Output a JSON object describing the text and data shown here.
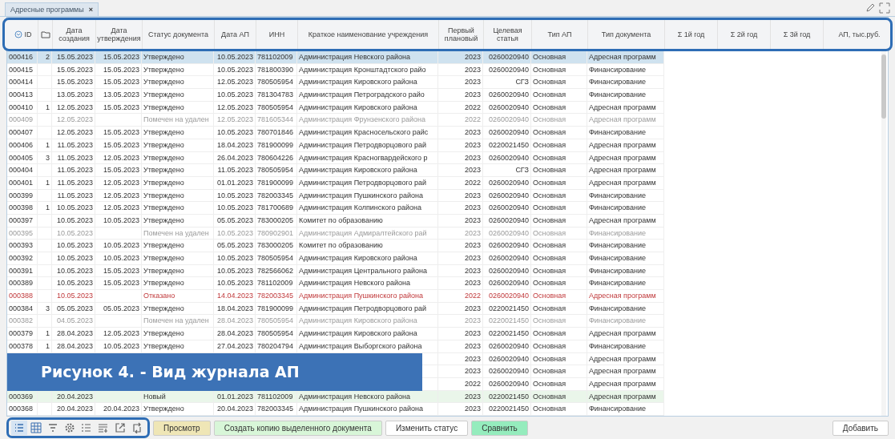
{
  "tab": {
    "label": "Адресные программы",
    "close": "×"
  },
  "columns": [
    "ID",
    "",
    "Дата создания",
    "Дата утверждения",
    "Статус документа",
    "Дата АП",
    "ИНН",
    "Краткое наименование учреждения",
    "Первый плановый",
    "Целевая статья",
    "Тип АП",
    "Тип документа",
    "Σ 1й год",
    "Σ 2й год",
    "Σ 3й год",
    "АП, тыс.руб."
  ],
  "rows": [
    {
      "covered": false,
      "kind": "approved",
      "selected": true,
      "cells": [
        "000416",
        "2",
        "15.05.2023",
        "15.05.2023",
        "Утверждено",
        "10.05.2023",
        "781102009",
        "Администрация Невского района",
        "2023",
        "0260020940",
        "Основная",
        "Адресная программ"
      ]
    },
    {
      "covered": false,
      "kind": "approved",
      "selected": false,
      "cells": [
        "000415",
        "",
        "15.05.2023",
        "15.05.2023",
        "Утверждено",
        "10.05.2023",
        "781800390",
        "Администрация Кронштадтского райо",
        "2023",
        "0260020940",
        "Основная",
        "Финансирование"
      ]
    },
    {
      "covered": false,
      "kind": "approved",
      "selected": false,
      "cells": [
        "000414",
        "",
        "15.05.2023",
        "15.05.2023",
        "Утверждено",
        "12.05.2023",
        "780505954",
        "Администрация Кировского района",
        "2023",
        "СГЗ",
        "Основная",
        "Финансирование"
      ]
    },
    {
      "covered": false,
      "kind": "approved",
      "selected": false,
      "cells": [
        "000413",
        "",
        "13.05.2023",
        "13.05.2023",
        "Утверждено",
        "10.05.2023",
        "781304783",
        "Администрация Петроградского райо",
        "2023",
        "0260020940",
        "Основная",
        "Финансирование"
      ]
    },
    {
      "covered": false,
      "kind": "approved",
      "selected": false,
      "cells": [
        "000410",
        "1",
        "12.05.2023",
        "15.05.2023",
        "Утверждено",
        "12.05.2023",
        "780505954",
        "Администрация Кировского района",
        "2022",
        "0260020940",
        "Основная",
        "Адресная программ"
      ]
    },
    {
      "covered": false,
      "kind": "deleted",
      "selected": false,
      "cells": [
        "000409",
        "",
        "12.05.2023",
        "",
        "Помечен на удален",
        "12.05.2023",
        "781605344",
        "Администрация Фрунзенского района",
        "2022",
        "0260020940",
        "Основная",
        "Адресная программ"
      ]
    },
    {
      "covered": false,
      "kind": "approved",
      "selected": false,
      "cells": [
        "000407",
        "",
        "12.05.2023",
        "15.05.2023",
        "Утверждено",
        "10.05.2023",
        "780701846",
        "Администрация Красносельского райс",
        "2023",
        "0260020940",
        "Основная",
        "Финансирование"
      ]
    },
    {
      "covered": false,
      "kind": "approved",
      "selected": false,
      "cells": [
        "000406",
        "1",
        "11.05.2023",
        "15.05.2023",
        "Утверждено",
        "18.04.2023",
        "781900099",
        "Администрация Петродворцового рай",
        "2023",
        "0220021450",
        "Основная",
        "Адресная программ"
      ]
    },
    {
      "covered": false,
      "kind": "approved",
      "selected": false,
      "cells": [
        "000405",
        "3",
        "11.05.2023",
        "12.05.2023",
        "Утверждено",
        "26.04.2023",
        "780604226",
        "Администрация Красногвардейского р",
        "2023",
        "0260020940",
        "Основная",
        "Адресная программ"
      ]
    },
    {
      "covered": false,
      "kind": "approved",
      "selected": false,
      "cells": [
        "000404",
        "",
        "11.05.2023",
        "15.05.2023",
        "Утверждено",
        "11.05.2023",
        "780505954",
        "Администрация Кировского района",
        "2023",
        "СГЗ",
        "Основная",
        "Адресная программ"
      ]
    },
    {
      "covered": false,
      "kind": "approved",
      "selected": false,
      "cells": [
        "000401",
        "1",
        "11.05.2023",
        "12.05.2023",
        "Утверждено",
        "01.01.2023",
        "781900099",
        "Администрация Петродворцового рай",
        "2022",
        "0260020940",
        "Основная",
        "Адресная программ"
      ]
    },
    {
      "covered": false,
      "kind": "approved",
      "selected": false,
      "cells": [
        "000399",
        "",
        "11.05.2023",
        "12.05.2023",
        "Утверждено",
        "10.05.2023",
        "782003345",
        "Администрация Пушкинского района",
        "2023",
        "0260020940",
        "Основная",
        "Финансирование"
      ]
    },
    {
      "covered": false,
      "kind": "approved",
      "selected": false,
      "cells": [
        "000398",
        "1",
        "10.05.2023",
        "12.05.2023",
        "Утверждено",
        "10.05.2023",
        "781700689",
        "Администрация Колпинского района",
        "2023",
        "0260020940",
        "Основная",
        "Финансирование"
      ]
    },
    {
      "covered": false,
      "kind": "approved",
      "selected": false,
      "cells": [
        "000397",
        "",
        "10.05.2023",
        "10.05.2023",
        "Утверждено",
        "05.05.2023",
        "783000205",
        "Комитет по образованию",
        "2023",
        "0260020940",
        "Основная",
        "Адресная программ"
      ]
    },
    {
      "covered": false,
      "kind": "deleted",
      "selected": false,
      "cells": [
        "000395",
        "",
        "10.05.2023",
        "",
        "Помечен на удален",
        "10.05.2023",
        "780902901",
        "Администрация Адмиралтейского рай",
        "2023",
        "0260020940",
        "Основная",
        "Финансирование"
      ]
    },
    {
      "covered": false,
      "kind": "approved",
      "selected": false,
      "cells": [
        "000393",
        "",
        "10.05.2023",
        "10.05.2023",
        "Утверждено",
        "05.05.2023",
        "783000205",
        "Комитет по образованию",
        "2023",
        "0260020940",
        "Основная",
        "Финансирование"
      ]
    },
    {
      "covered": false,
      "kind": "approved",
      "selected": false,
      "cells": [
        "000392",
        "",
        "10.05.2023",
        "10.05.2023",
        "Утверждено",
        "10.05.2023",
        "780505954",
        "Администрация Кировского района",
        "2023",
        "0260020940",
        "Основная",
        "Финансирование"
      ]
    },
    {
      "covered": false,
      "kind": "approved",
      "selected": false,
      "cells": [
        "000391",
        "",
        "10.05.2023",
        "15.05.2023",
        "Утверждено",
        "10.05.2023",
        "782566062",
        "Администрация Центрального района",
        "2023",
        "0260020940",
        "Основная",
        "Финансирование"
      ]
    },
    {
      "covered": false,
      "kind": "approved",
      "selected": false,
      "cells": [
        "000389",
        "",
        "10.05.2023",
        "15.05.2023",
        "Утверждено",
        "10.05.2023",
        "781102009",
        "Администрация Невского района",
        "2023",
        "0260020940",
        "Основная",
        "Финансирование"
      ]
    },
    {
      "covered": false,
      "kind": "rejected",
      "selected": false,
      "cells": [
        "000388",
        "",
        "10.05.2023",
        "",
        "Отказано",
        "14.04.2023",
        "782003345",
        "Администрация Пушкинского района",
        "2022",
        "0260020940",
        "Основная",
        "Адресная программ"
      ]
    },
    {
      "covered": false,
      "kind": "approved",
      "selected": false,
      "cells": [
        "000384",
        "3",
        "05.05.2023",
        "05.05.2023",
        "Утверждено",
        "18.04.2023",
        "781900099",
        "Администрация Петродворцового рай",
        "2023",
        "0220021450",
        "Основная",
        "Финансирование"
      ]
    },
    {
      "covered": false,
      "kind": "deleted",
      "selected": false,
      "cells": [
        "000382",
        "",
        "04.05.2023",
        "",
        "Помечен на удален",
        "28.04.2023",
        "780505954",
        "Администрация Кировского района",
        "2023",
        "0220021450",
        "Основная",
        "Финансирование"
      ]
    },
    {
      "covered": false,
      "kind": "approved",
      "selected": false,
      "cells": [
        "000379",
        "1",
        "28.04.2023",
        "12.05.2023",
        "Утверждено",
        "28.04.2023",
        "780505954",
        "Администрация Кировского района",
        "2023",
        "0220021450",
        "Основная",
        "Адресная программ"
      ]
    },
    {
      "covered": false,
      "kind": "approved",
      "selected": false,
      "cells": [
        "000378",
        "1",
        "28.04.2023",
        "10.05.2023",
        "Утверждено",
        "27.04.2023",
        "780204794",
        "Администрация Выборгского района",
        "2023",
        "0260020940",
        "Основная",
        "Финансирование"
      ]
    },
    {
      "covered": true,
      "kind": "approved",
      "selected": false,
      "cells": [
        "",
        "",
        "",
        "",
        "",
        "",
        "",
        "",
        "2023",
        "0260020940",
        "Основная",
        "Адресная программ"
      ]
    },
    {
      "covered": true,
      "kind": "approved",
      "selected": false,
      "cells": [
        "",
        "",
        "",
        "",
        "",
        "",
        "",
        "",
        "2023",
        "0260020940",
        "Основная",
        "Адресная программ"
      ]
    },
    {
      "covered": true,
      "kind": "approved",
      "selected": false,
      "cells": [
        "",
        "",
        "",
        "",
        "",
        "",
        "",
        "",
        "2022",
        "0260020940",
        "Основная",
        "Адресная программ"
      ]
    },
    {
      "covered": false,
      "kind": "new",
      "selected": false,
      "cells": [
        "000369",
        "",
        "20.04.2023",
        "",
        "Новый",
        "01.01.2023",
        "781102009",
        "Администрация Невского района",
        "2023",
        "0220021450",
        "Основная",
        "Адресная программ"
      ]
    },
    {
      "covered": false,
      "kind": "approved",
      "selected": false,
      "cells": [
        "000368",
        "",
        "20.04.2023",
        "20.04.2023",
        "Утверждено",
        "20.04.2023",
        "782003345",
        "Администрация Пушкинского района",
        "2023",
        "0220021450",
        "Основная",
        "Финансирование"
      ]
    }
  ],
  "caption": "Рисунок 4. - Вид журнала АП",
  "tools": [
    {
      "kind": "list",
      "selected": true
    },
    {
      "kind": "grid",
      "selected": false
    },
    {
      "kind": "filter",
      "selected": false
    },
    {
      "kind": "gear",
      "selected": false
    },
    {
      "kind": "numbered",
      "selected": false
    },
    {
      "kind": "sort",
      "selected": false
    },
    {
      "kind": "export",
      "selected": false
    },
    {
      "kind": "swap",
      "selected": false
    }
  ],
  "actions": [
    {
      "label": "Просмотр",
      "kind": "view"
    },
    {
      "label": "Создать копию выделенного документа",
      "kind": "copy"
    },
    {
      "label": "Изменить статус",
      "kind": "plain"
    },
    {
      "label": "Сравнить",
      "kind": "compare"
    }
  ],
  "add_button": "Добавить"
}
